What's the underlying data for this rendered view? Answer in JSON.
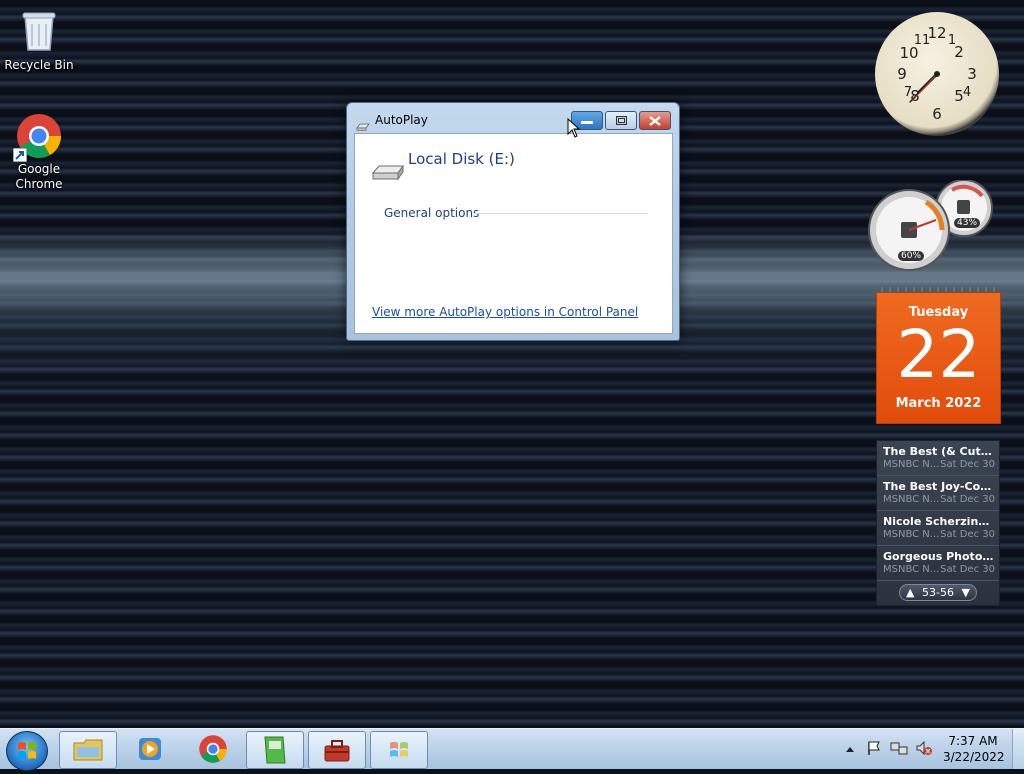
{
  "desktop": {
    "icons": [
      {
        "label": "Recycle Bin",
        "icon": "recycle-bin-icon"
      },
      {
        "label": "Google Chrome",
        "icon": "chrome-icon"
      }
    ]
  },
  "autoplay": {
    "title": "AutoPlay",
    "drive_label": "Local Disk (E:)",
    "section_label": "General options",
    "control_panel_link": "View more AutoPlay options in Control Panel",
    "buttons": {
      "minimize": "minimize",
      "maximize": "maximize",
      "close": "close"
    }
  },
  "gadgets": {
    "clock": {
      "time": "7:37"
    },
    "cpu_meter": {
      "cpu_percent": "60%",
      "memory_percent": "43%"
    },
    "calendar": {
      "weekday": "Tuesday",
      "day": "22",
      "month_year": "March 2022"
    },
    "feed": {
      "items": [
        {
          "title": "The Best (& Cutest & Most...",
          "source": "MSNBC N...",
          "date": "Sat Dec 30"
        },
        {
          "title": "The Best Joy-Con Alternatives",
          "source": "MSNBC N...",
          "date": "Sat Dec 30"
        },
        {
          "title": "Nicole Scherzinger Gets...",
          "source": "MSNBC N...",
          "date": "Sat Dec 30"
        },
        {
          "title": "Gorgeous Photos of ...",
          "source": "MSNBC N...",
          "date": "Sat Dec 30"
        }
      ],
      "range": "53-56"
    }
  },
  "taskbar": {
    "apps": [
      "file-explorer",
      "media-player",
      "chrome",
      "green-app",
      "toolbox-app",
      "windows-app"
    ],
    "clock_time": "7:37 AM",
    "clock_date": "3/22/2022"
  },
  "colors": {
    "calendar_orange": "#e9560f",
    "link_blue": "#1a4fa8",
    "title_blue": "#1e3d8f"
  }
}
